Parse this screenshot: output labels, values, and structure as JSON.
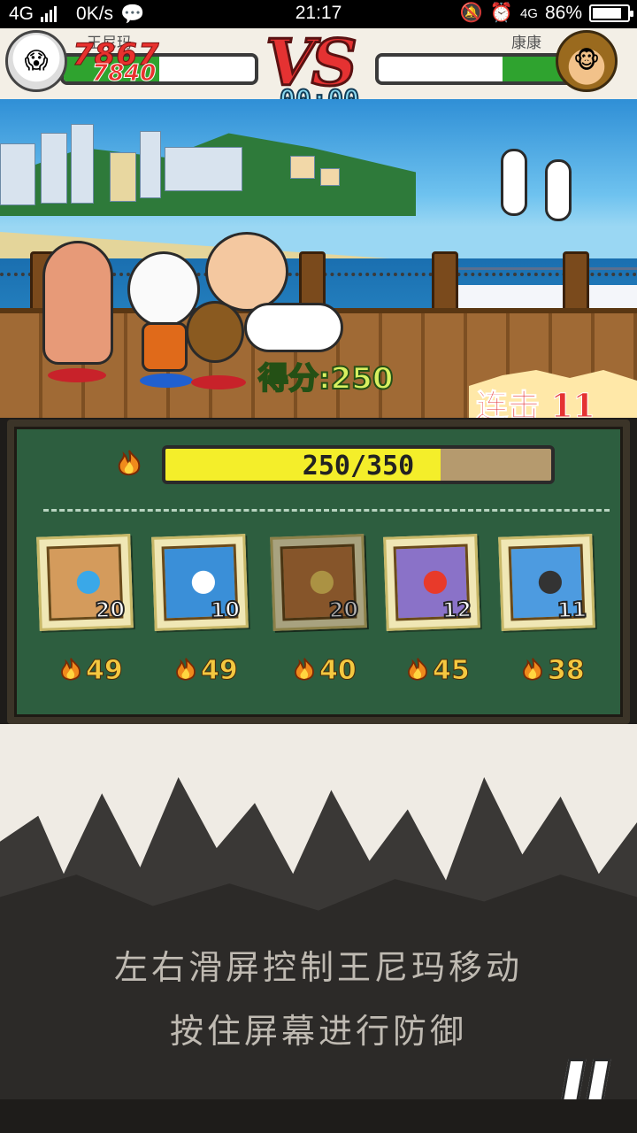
{
  "status_bar": {
    "network": "4G",
    "speed": "0K/s",
    "time": "21:17",
    "network2": "4G",
    "battery": "86%",
    "battery_level": 0.86
  },
  "hud": {
    "player_left_name": "王尼玛",
    "player_right_name": "康康",
    "score_primary": "7867",
    "score_secondary": "7840",
    "vs_label": "VS",
    "timer": "00:00",
    "hp_left": 0.5,
    "hp_right": 0.36
  },
  "scene": {
    "score_label": "得分:",
    "score_value": "250",
    "combo_label": "连击",
    "combo_value": "11"
  },
  "energy": {
    "text": "250/350",
    "current": 250,
    "max": 350
  },
  "skills": [
    {
      "icon": "energy-ball-icon",
      "count": "20",
      "cost": "49",
      "colors": [
        "#d49b5c",
        "#3aa8e8"
      ]
    },
    {
      "icon": "lightning-hand-icon",
      "count": "10",
      "cost": "49",
      "colors": [
        "#3a8fd8",
        "#ffffff"
      ]
    },
    {
      "icon": "explosion-icon",
      "count": "20",
      "cost": "40",
      "colors": [
        "#c07a3c",
        "#f4d060"
      ]
    },
    {
      "icon": "flying-kick-icon",
      "count": "12",
      "cost": "45",
      "colors": [
        "#8a72c8",
        "#e83a2a"
      ]
    },
    {
      "icon": "shuriken-icon",
      "count": "11",
      "cost": "38",
      "colors": [
        "#4d9be0",
        "#333333"
      ]
    }
  ],
  "tips": {
    "line1": "左右滑屏控制王尼玛移动",
    "line2": "按住屏幕进行防御"
  },
  "controls": {
    "pause_icon": "pause-icon"
  }
}
